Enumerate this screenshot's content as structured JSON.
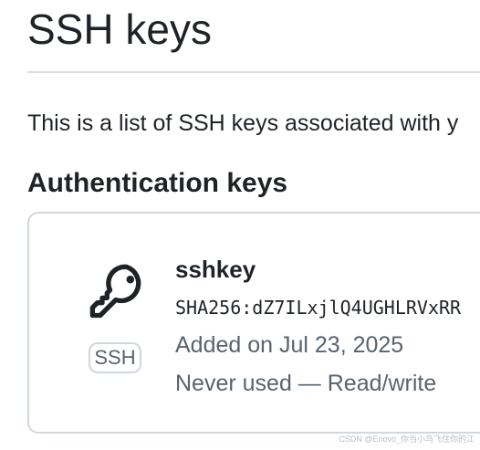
{
  "page": {
    "title": "SSH keys",
    "intro": "This is a list of SSH keys associated with y"
  },
  "section": {
    "heading": "Authentication keys"
  },
  "key": {
    "icon": "key-icon",
    "type_badge": "SSH",
    "name": "sshkey",
    "fingerprint": "SHA256:dZ7ILxjlQ4UGHLRVxRR",
    "added": "Added on Jul 23, 2025",
    "usage": "Never used — Read/write"
  },
  "watermark": "CSDN @Enovo_你当小鸟飞住你的江",
  "colors": {
    "text": "#1f2328",
    "muted": "#59636e",
    "border": "#d0d7de"
  }
}
